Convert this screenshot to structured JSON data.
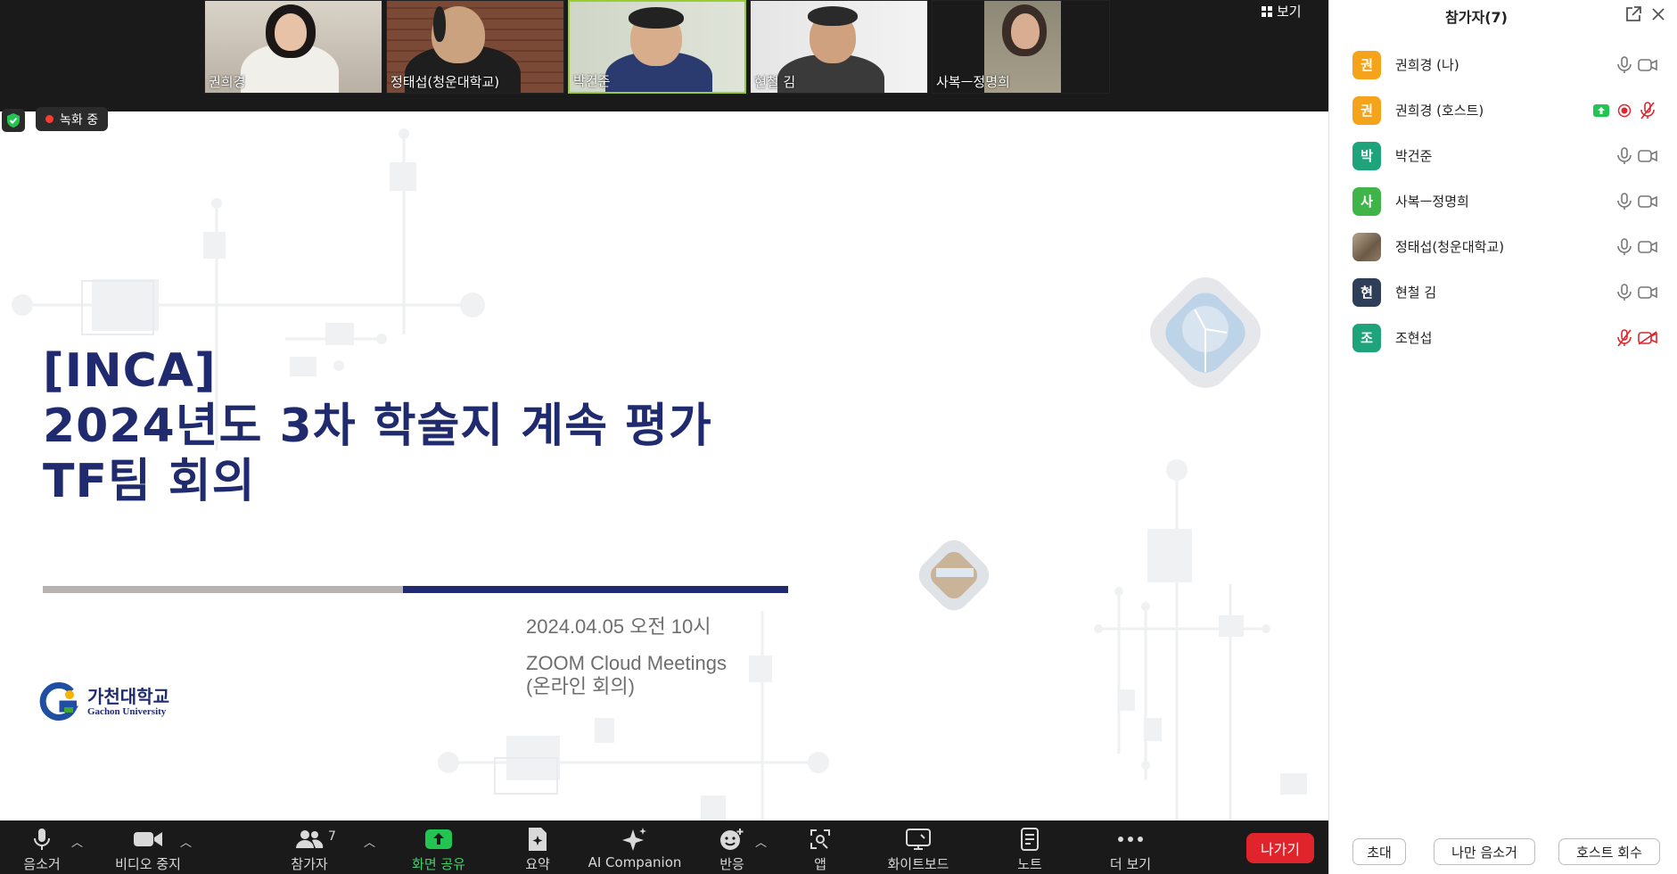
{
  "video_tiles": [
    {
      "name": "권희경",
      "active": false
    },
    {
      "name": "정태섭(청운대학교)",
      "active": false
    },
    {
      "name": "박건준",
      "active": true
    },
    {
      "name": "현철 김",
      "active": false
    },
    {
      "name": "사복ㅡ정명희",
      "active": false
    }
  ],
  "view_label": "보기",
  "recording_label": "녹화 중",
  "slide": {
    "title_line1": "[INCA]",
    "title_line2": "2024년도 3차 학술지 계속 평가",
    "title_line3": "TF팀 회의",
    "date": "2024.04.05  오전 10시",
    "platform_line1": "ZOOM Cloud Meetings",
    "platform_line2": "(온라인 회의)",
    "logo_ko": "가천대학교",
    "logo_en": "Gachon University"
  },
  "toolbar": {
    "mute": "음소거",
    "stop_video": "비디오 중지",
    "participants": "참가자",
    "participants_count": "7",
    "share_screen": "화면 공유",
    "summary": "요약",
    "ai_companion": "AI Companion",
    "reactions": "반응",
    "apps": "앱",
    "whiteboard": "화이트보드",
    "notes": "노트",
    "more": "더 보기",
    "leave": "나가기"
  },
  "panel": {
    "title": "참가자(7)",
    "participants": [
      {
        "initial": "권",
        "name": "권희경 (나)",
        "color": "#f5a31a"
      },
      {
        "initial": "권",
        "name": "권희경 (호스트)",
        "color": "#f5a31a"
      },
      {
        "initial": "박",
        "name": "박건준",
        "color": "#1fa37a"
      },
      {
        "initial": "사",
        "name": "사복ㅡ정명희",
        "color": "#3fb549"
      },
      {
        "initial": "",
        "name": "정태섭(청운대학교)",
        "color": "#8a7a66"
      },
      {
        "initial": "현",
        "name": "현철 김",
        "color": "#2f3e58"
      },
      {
        "initial": "조",
        "name": "조현섭",
        "color": "#1fa37a"
      }
    ],
    "invite": "초대",
    "mute_me": "나만 음소거",
    "reclaim_host": "호스트 회수"
  },
  "colors": {
    "slide_navy": "#1f2b6e",
    "share_green": "#3fd26a",
    "leave_red": "#e0242b",
    "muted_red": "#e0242b"
  }
}
